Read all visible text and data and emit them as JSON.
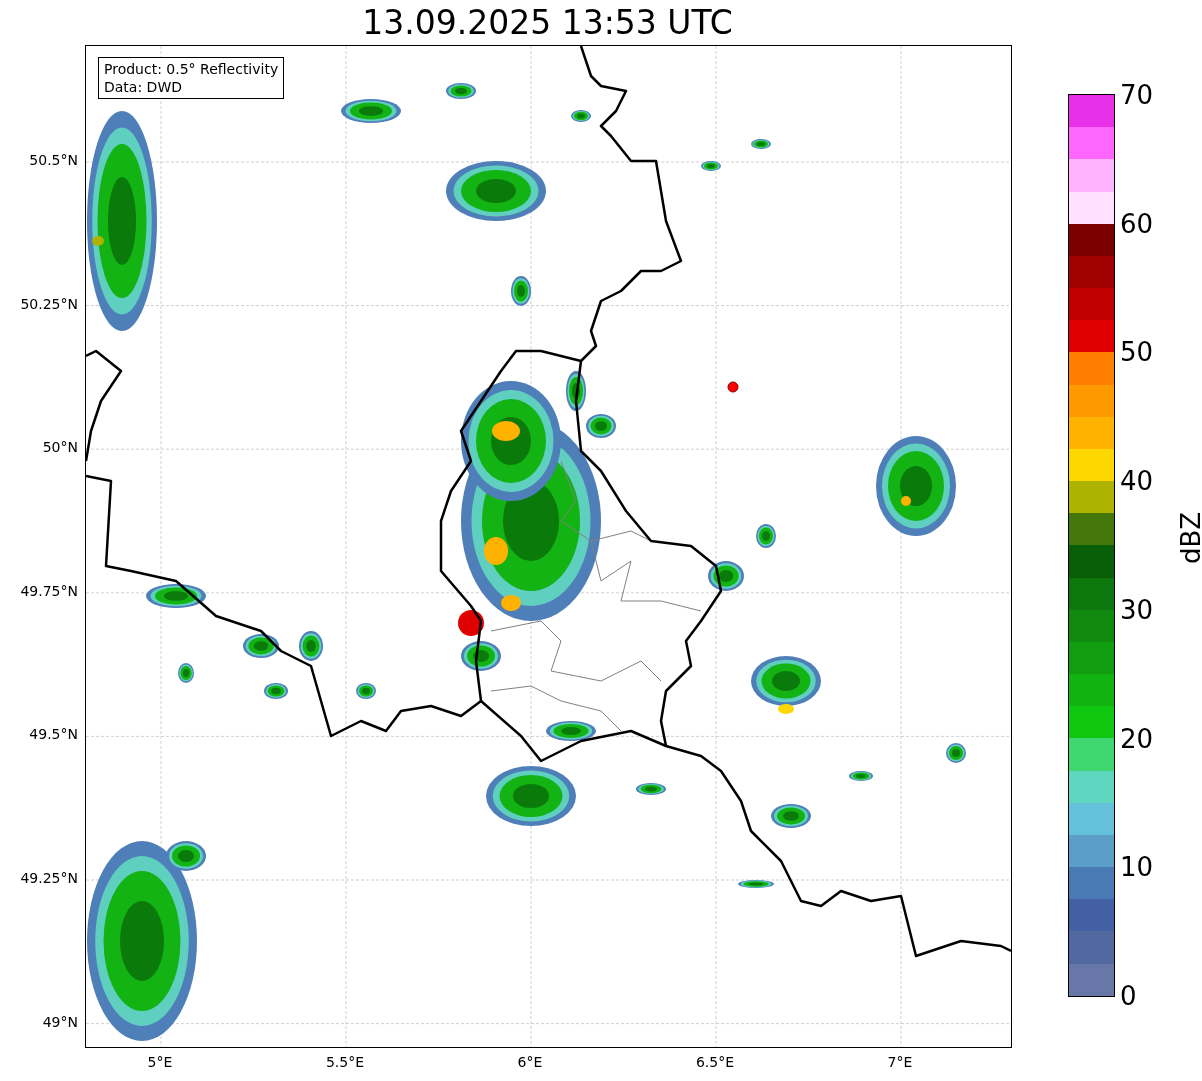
{
  "title": "13.09.2025 13:53 UTC",
  "info_box": {
    "lines": [
      "Product: 0.5° Reflectivity",
      "Data: DWD"
    ]
  },
  "map": {
    "y_ticks": [
      "50.5°N",
      "50.25°N",
      "50°N",
      "49.75°N",
      "49.5°N",
      "49.25°N",
      "49°N"
    ],
    "x_ticks": [
      "5°E",
      "5.5°E",
      "6°E",
      "6.5°E",
      "7°E"
    ]
  },
  "colorbar": {
    "label": "dBZ",
    "ticks": [
      "70",
      "60",
      "50",
      "40",
      "30",
      "20",
      "10",
      "0"
    ],
    "segments": [
      {
        "color": "#e930e9"
      },
      {
        "color": "#ff66ff"
      },
      {
        "color": "#ffb3ff"
      },
      {
        "color": "#ffe0ff"
      },
      {
        "color": "#7a0000"
      },
      {
        "color": "#a00000"
      },
      {
        "color": "#c00000"
      },
      {
        "color": "#e00000"
      },
      {
        "color": "#ff7f00"
      },
      {
        "color": "#ff9900"
      },
      {
        "color": "#ffb300"
      },
      {
        "color": "#ffd700"
      },
      {
        "color": "#adb300"
      },
      {
        "color": "#45780a"
      },
      {
        "color": "#085f08"
      },
      {
        "color": "#0c770c"
      },
      {
        "color": "#0f8a0f"
      },
      {
        "color": "#109d10"
      },
      {
        "color": "#11b311"
      },
      {
        "color": "#10c810"
      },
      {
        "color": "#3fd770"
      },
      {
        "color": "#5fd6c0"
      },
      {
        "color": "#65c1db"
      },
      {
        "color": "#5b9ec8"
      },
      {
        "color": "#4a7ab4"
      },
      {
        "color": "#4460a4"
      },
      {
        "color": "#5268a0"
      },
      {
        "color": "#6778a8"
      }
    ]
  }
}
